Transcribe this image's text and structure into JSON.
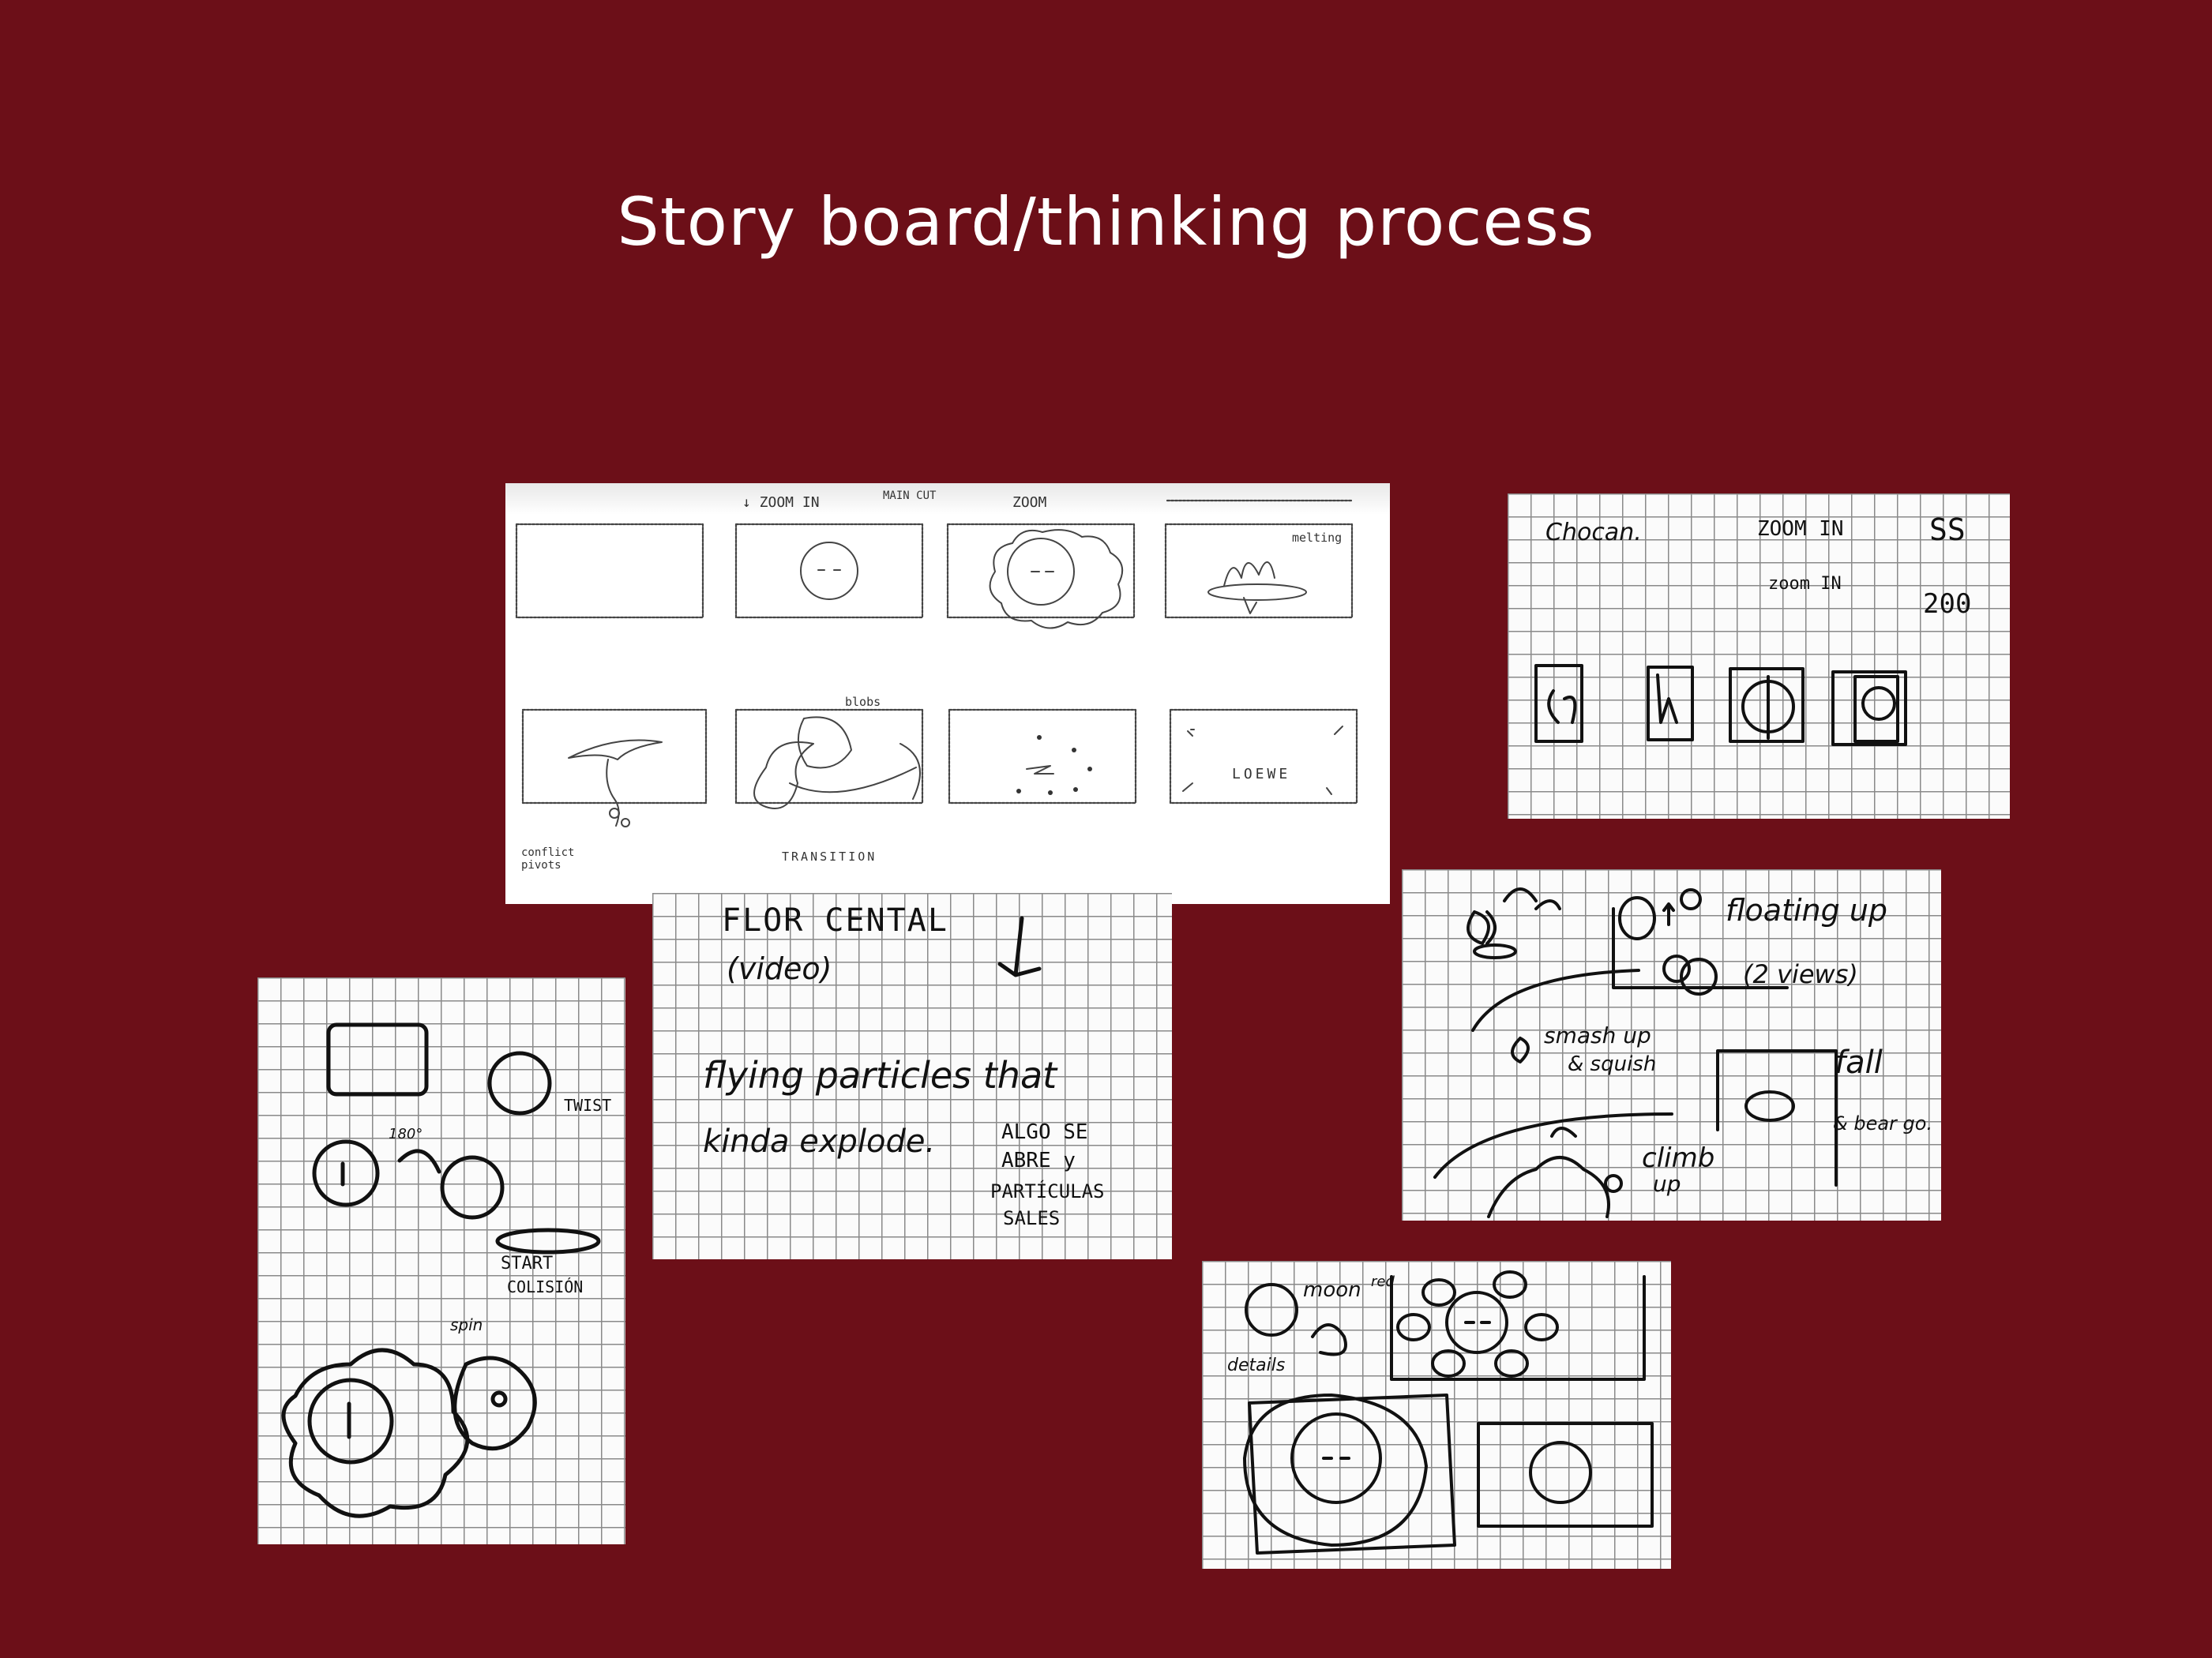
{
  "title": "Story board/thinking process",
  "colors": {
    "background": "#6c0f18",
    "title": "#ffffff",
    "paper": "#ffffff",
    "ink": "#111111"
  },
  "storyboard_sheet": {
    "top_notes": {
      "zoom_in": "↓ ZOOM IN",
      "main_cut": "MAIN CUT",
      "zoom": "ZOOM"
    },
    "frame4_note": "melting",
    "frame6_note": "blobs",
    "frame5_note": "conflict pivots",
    "transition": "TRANSITION",
    "frame8_label": "LOEWE"
  },
  "sketch_top_right": {
    "word": "Chocan.",
    "zoom_in": "ZOOM IN",
    "zoom_in2": "zoom IN",
    "num1": "SS",
    "num2": "200"
  },
  "sketch_left": {
    "angle": "180°",
    "twist": "TWIST",
    "start": "START",
    "collision": "COLISIÓN",
    "note": "spin"
  },
  "sketch_center": {
    "line1": "FLOR CENTAL",
    "line2": "(video)",
    "line3": "flying particles that",
    "line4": "kinda explode.",
    "spanish1": "ALGO SE",
    "spanish2": "ABRE y",
    "spanish3": "PARTÍCULAS",
    "spanish4": "SALES"
  },
  "sketch_right": {
    "floating": "floating up",
    "views": "(2 views)",
    "smash": "smash up",
    "squish": "& squish",
    "fall": "fall",
    "beat": "& bear go.",
    "climb": "climb",
    "up": "up"
  },
  "sketch_bottom_right": {
    "moon": "moon",
    "red": "red",
    "details": "details"
  }
}
